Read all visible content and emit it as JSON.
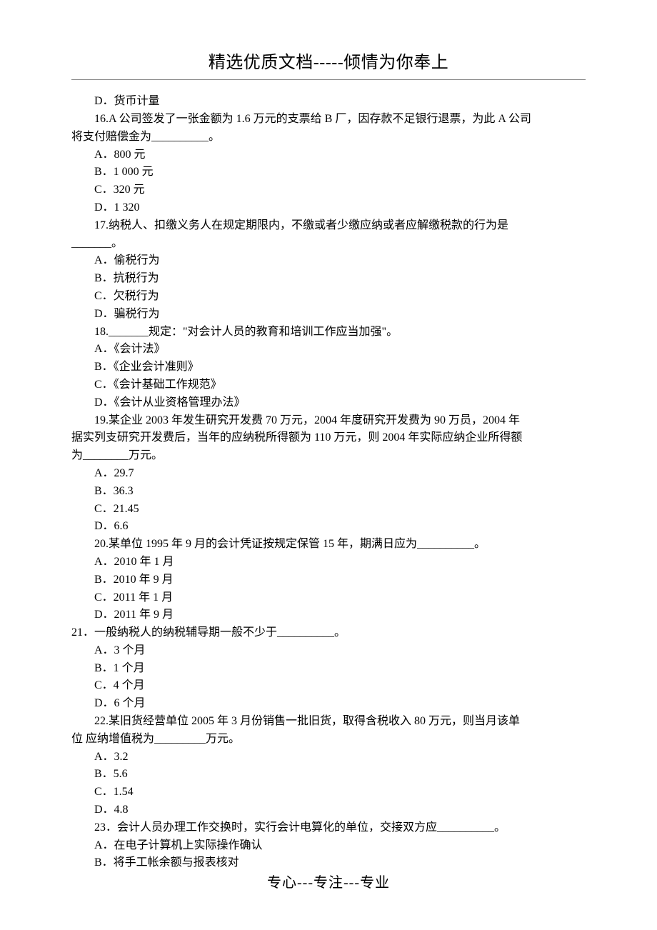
{
  "header": "精选优质文档-----倾情为你奉上",
  "footer": "专心---专注---专业",
  "lines": {
    "l0": "D．货币计量",
    "l1a": "16.A 公司签发了一张金额为 1.6 万元的支票给 B 厂，因存款不足银行退票，为此 A 公司",
    "l1b": "将支付赔偿金为__________。",
    "l2": "A．800 元",
    "l3": "B．1 000 元",
    "l4": "C．320 元",
    "l5": "D．1 320",
    "l6a": "17.纳税人、扣缴义务人在规定期限内，不缴或者少缴应纳或者应解缴税款的行为是",
    "l6b": "_______。",
    "l7": "A．偷税行为",
    "l8": "B．抗税行为",
    "l9": "C．欠税行为",
    "l10": "D．骗税行为",
    "l11": "18._______规定：\"对会计人员的教育和培训工作应当加强\"。",
    "l12": "A．《会计法》",
    "l13": "B．《企业会计准则》",
    "l14": "C．《会计基础工作规范》",
    "l15": "D．《会计从业资格管理办法》",
    "l16a": "19.某企业 2003 年发生研究开发费 70 万元，2004 年度研究开发费为 90 万员，2004 年",
    "l16b": "据实列支研究开发费后，当年的应纳税所得额为 110 万元，则 2004 年实际应纳企业所得额",
    "l16c": "为________万元。",
    "l17": "A．29.7",
    "l18": "B．36.3",
    "l19": "C．21.45",
    "l20": "D．6.6",
    "l21": "20.某单位 1995 年 9 月的会计凭证按规定保管 15 年，期满日应为__________。",
    "l22": "A．2010 年 1 月",
    "l23": "B．2010 年 9 月",
    "l24": "C．2011 年 1 月",
    "l25": "D．2011 年 9 月",
    "l26": "21．一般纳税人的纳税辅导期一般不少于__________。",
    "l27": "A．3 个月",
    "l28": "B．1 个月",
    "l29": "C．4 个月",
    "l30": "D．6 个月",
    "l31a": "22.某旧货经营单位 2005 年 3 月份销售一批旧货，取得含税收入 80 万元，则当月该单",
    "l31b": "位  应纳增值税为_________万元。",
    "l32": "A．3.2",
    "l33": "B．5.6",
    "l34": "C．1.54",
    "l35": "D．4.8",
    "l36": "23．会计人员办理工作交换时，实行会计电算化的单位，交接双方应__________。",
    "l37": "A．在电子计算机上实际操作确认",
    "l38": "B．将手工帐余额与报表核对"
  }
}
